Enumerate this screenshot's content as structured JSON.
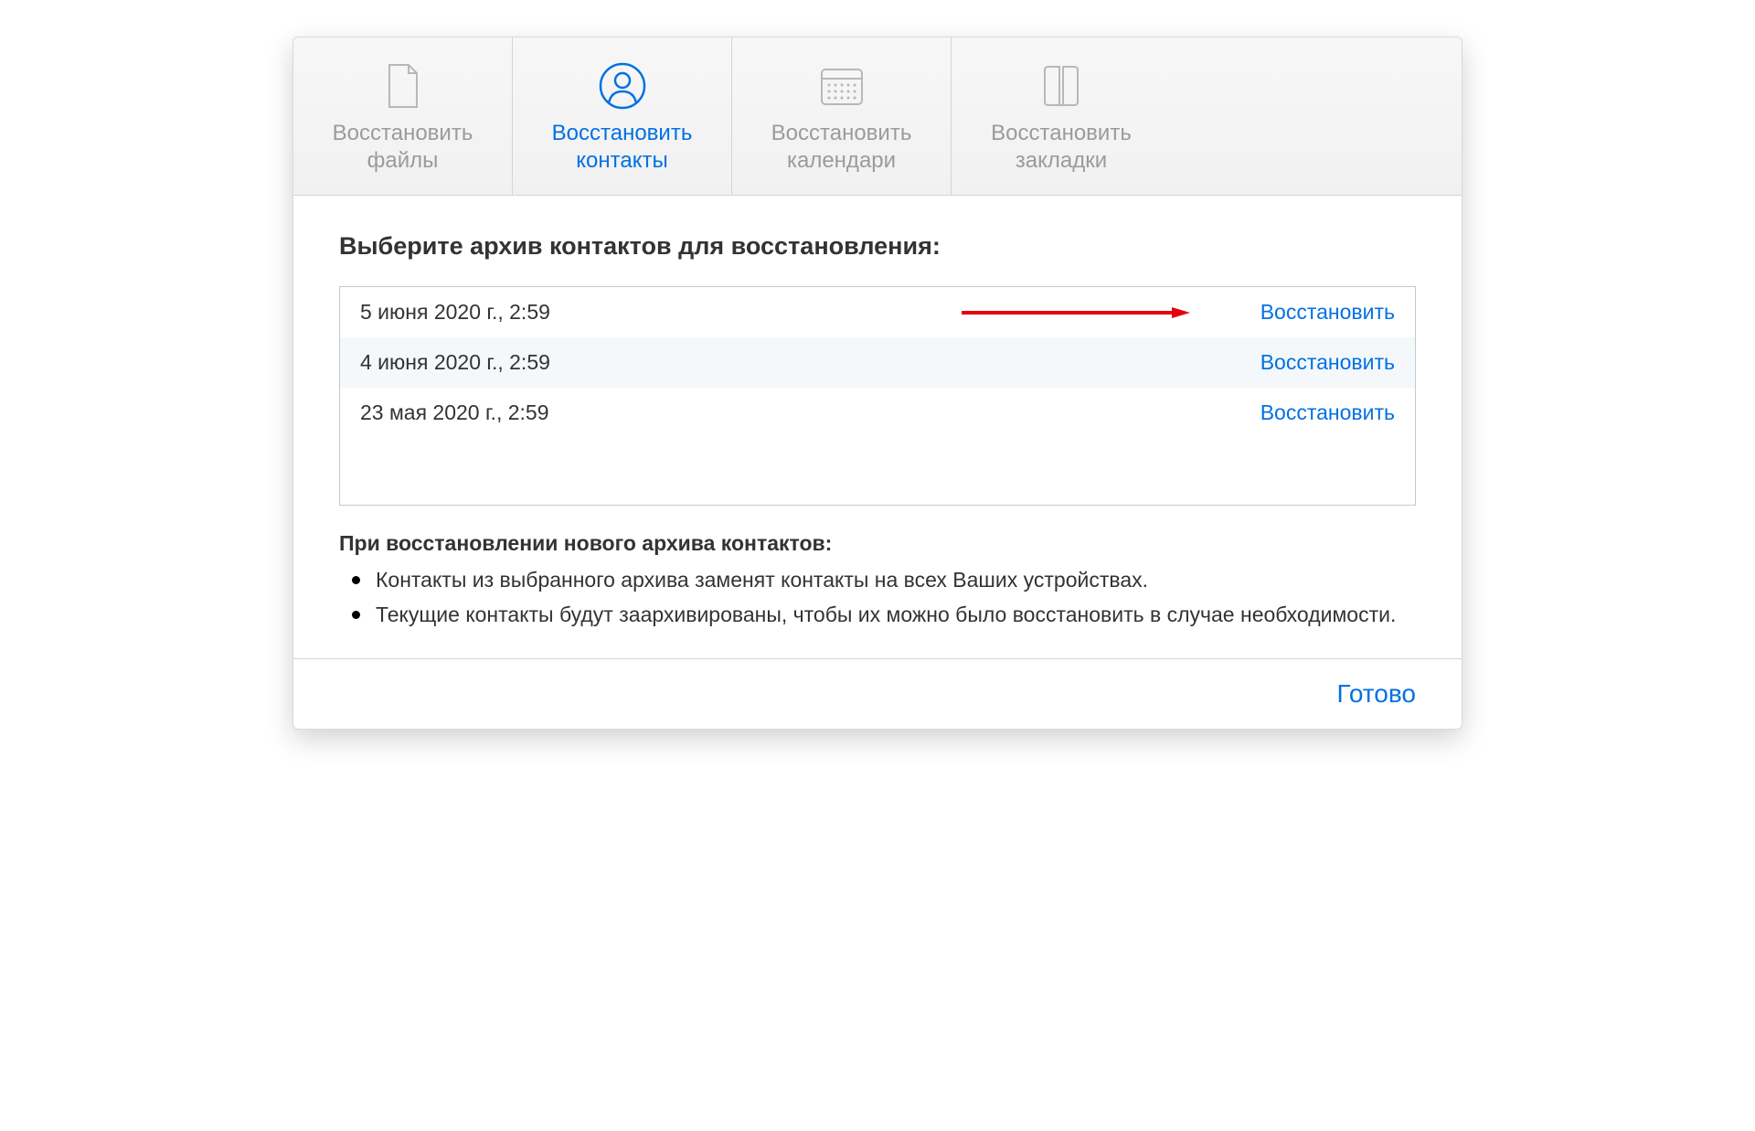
{
  "tabs": {
    "files": "Восстановить\nфайлы",
    "contacts": "Восстановить\nконтакты",
    "calendars": "Восстановить\nкалендари",
    "bookmarks": "Восстановить\nзакладки"
  },
  "main": {
    "heading": "Выберите архив контактов для восстановления:",
    "archives": [
      {
        "date": "5 июня 2020 г., 2:59",
        "action": "Восстановить"
      },
      {
        "date": "4 июня 2020 г., 2:59",
        "action": "Восстановить"
      },
      {
        "date": "23 мая 2020 г., 2:59",
        "action": "Восстановить"
      }
    ],
    "info_heading": "При восстановлении нового архива контактов:",
    "bullets": [
      "Контакты из выбранного архива заменят контакты на всех Ваших устройствах.",
      "Текущие контакты будут заархивированы, чтобы их можно было восстановить в случае необходимости."
    ]
  },
  "footer": {
    "done": "Готово"
  },
  "colors": {
    "accent": "#0071e3",
    "inactive": "#9b9b9b"
  }
}
